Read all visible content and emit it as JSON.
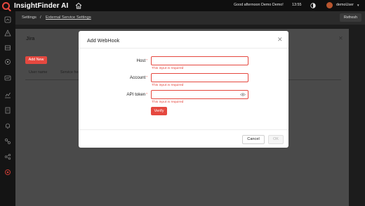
{
  "header": {
    "app_name": "InsightFinder AI",
    "greeting": "Good afternoon Demo Demo!",
    "time": "13:55",
    "username": "demoUser"
  },
  "breadcrumb": {
    "root": "Settings",
    "separator": "/",
    "current": "External Service Settings"
  },
  "toolbar": {
    "refresh_label": "Refresh"
  },
  "background_panel": {
    "title": "Jira",
    "add_new_label": "Add New",
    "columns": [
      "User name",
      "Service ho"
    ]
  },
  "modal": {
    "title": "Add WebHook",
    "fields": [
      {
        "label": "Host",
        "value": "",
        "error": "This input is required"
      },
      {
        "label": "Account",
        "value": "",
        "error": "This input is required"
      },
      {
        "label": "API token",
        "value": "",
        "error": "This input is required"
      }
    ],
    "verify_label": "Verify",
    "cancel_label": "Cancel",
    "ok_label": "OK"
  },
  "colors": {
    "accent": "#e5483f",
    "overlay": "#4a4a4a",
    "topbar": "#0f0f0f"
  },
  "icons": [
    "home-icon",
    "theme-toggle-icon",
    "close-icon",
    "eye-icon",
    "nav-icons"
  ]
}
